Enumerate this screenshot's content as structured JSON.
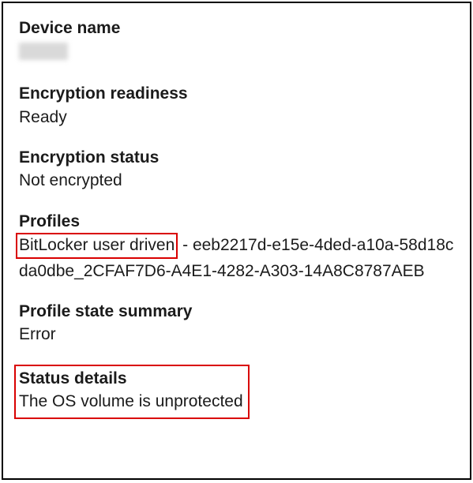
{
  "device_name": {
    "label": "Device name",
    "value": ""
  },
  "encryption_readiness": {
    "label": "Encryption readiness",
    "value": "Ready"
  },
  "encryption_status": {
    "label": "Encryption status",
    "value": "Not encrypted"
  },
  "profiles": {
    "label": "Profiles",
    "highlighted_name": "BitLocker user driven",
    "separator": " - ",
    "id_suffix": "eeb2217d-e15e-4ded-a10a-58d18cda0dbe_2CFAF7D6-A4E1-4282-A303-14A8C8787AEB"
  },
  "profile_state_summary": {
    "label": "Profile state summary",
    "value": "Error"
  },
  "status_details": {
    "label": "Status details",
    "value": "The OS volume is unprotected"
  }
}
